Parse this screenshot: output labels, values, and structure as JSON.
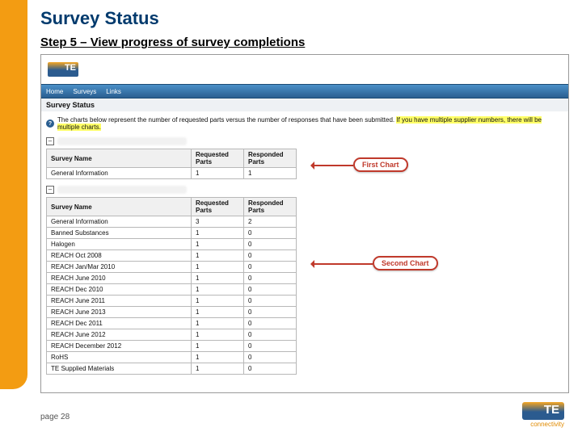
{
  "slide": {
    "title": "Survey Status",
    "subtitle": "Step 5 – View progress of survey completions",
    "page_label": "page 28"
  },
  "footer": {
    "brand_tag": "connectivity"
  },
  "app": {
    "nav": {
      "home": "Home",
      "surveys": "Surveys",
      "links": "Links"
    },
    "section_title": "Survey Status",
    "info_text_plain": "The charts below represent the number of requested parts versus the number of responses that have been submitted.",
    "info_text_highlight": "If you have multiple supplier numbers, there will be multiple charts.",
    "columns": {
      "name": "Survey Name",
      "req": "Requested Parts",
      "resp": "Responded Parts"
    },
    "callouts": {
      "first": "First Chart",
      "second": "Second Chart"
    },
    "chart1": {
      "rows": [
        {
          "name": "General Information",
          "req": "1",
          "resp": "1"
        }
      ]
    },
    "chart2": {
      "rows": [
        {
          "name": "General Information",
          "req": "3",
          "resp": "2"
        },
        {
          "name": "Banned Substances",
          "req": "1",
          "resp": "0"
        },
        {
          "name": "Halogen",
          "req": "1",
          "resp": "0"
        },
        {
          "name": "REACH Oct 2008",
          "req": "1",
          "resp": "0"
        },
        {
          "name": "REACH Jan/Mar 2010",
          "req": "1",
          "resp": "0"
        },
        {
          "name": "REACH June 2010",
          "req": "1",
          "resp": "0"
        },
        {
          "name": "REACH Dec 2010",
          "req": "1",
          "resp": "0"
        },
        {
          "name": "REACH June 2011",
          "req": "1",
          "resp": "0"
        },
        {
          "name": "REACH June 2013",
          "req": "1",
          "resp": "0"
        },
        {
          "name": "REACH Dec 2011",
          "req": "1",
          "resp": "0"
        },
        {
          "name": "REACH June 2012",
          "req": "1",
          "resp": "0"
        },
        {
          "name": "REACH December 2012",
          "req": "1",
          "resp": "0"
        },
        {
          "name": "RoHS",
          "req": "1",
          "resp": "0"
        },
        {
          "name": "TE Supplied Materials",
          "req": "1",
          "resp": "0"
        }
      ]
    }
  }
}
